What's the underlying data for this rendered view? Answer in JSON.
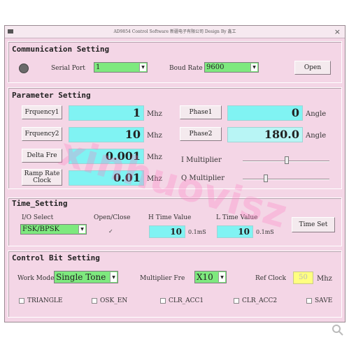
{
  "window": {
    "title": "AD9854 Control Software   新疆电子有限公司   Design By 鑫工",
    "close_glyph": "×"
  },
  "communication": {
    "title": "Communication Setting",
    "serial_port_label": "Serial Port",
    "serial_port_value": "1",
    "baud_rate_label": "Boud Rate",
    "baud_rate_value": "9600",
    "open_button": "Open"
  },
  "parameter": {
    "title": "Parameter Setting",
    "frequency1_button": "Frquency1",
    "frequency1_value": "1",
    "frequency1_unit": "Mhz",
    "frequency2_button": "Frquency2",
    "frequency2_value": "10",
    "frequency2_unit": "Mhz",
    "delta_button": "Delta Fre",
    "delta_value": "0.001",
    "delta_unit": "Mhz",
    "ramp_button": "Ramp Rate Clock",
    "ramp_value": "0.01",
    "ramp_unit": "Mhz",
    "phase1_button": "Phase1",
    "phase1_value": "0",
    "phase1_unit": "Angle",
    "phase2_button": "Phase2",
    "phase2_value": "180.0",
    "phase2_unit": "Angle",
    "i_multiplier_label": "I Multiplier",
    "q_multiplier_label": "Q Multiplier"
  },
  "time": {
    "title": "Time_Setting",
    "io_select_label": "I/O Select",
    "io_select_value": "FSK/BPSK",
    "open_close_label": "Open/Close",
    "open_close_checked": "✓",
    "h_time_label": "H Time Value",
    "h_time_value": "10",
    "h_time_unit": "0.1mS",
    "l_time_label": "L Time Value",
    "l_time_value": "10",
    "l_time_unit": "0.1mS",
    "time_set_button": "Time Set"
  },
  "control": {
    "title": "Control Bit Setting",
    "work_mode_label": "Work Mode",
    "work_mode_value": "Single Tone",
    "multiplier_label": "Multiplier Fre",
    "multiplier_value": "X10",
    "ref_clock_label": "Ref Clock",
    "ref_clock_value": "50",
    "ref_clock_unit": "Mhz",
    "checkboxes": [
      "TRIANGLE",
      "OSK_EN",
      "CLR_ACC1",
      "CLR_ACC2",
      "SAVE"
    ]
  },
  "watermark": "xinhuovisz",
  "colors": {
    "window_bg": "#f4d6e6",
    "cyan_field": "#80f3f3",
    "green_combo": "#7ee97e",
    "yellow_field": "#ffff80"
  }
}
